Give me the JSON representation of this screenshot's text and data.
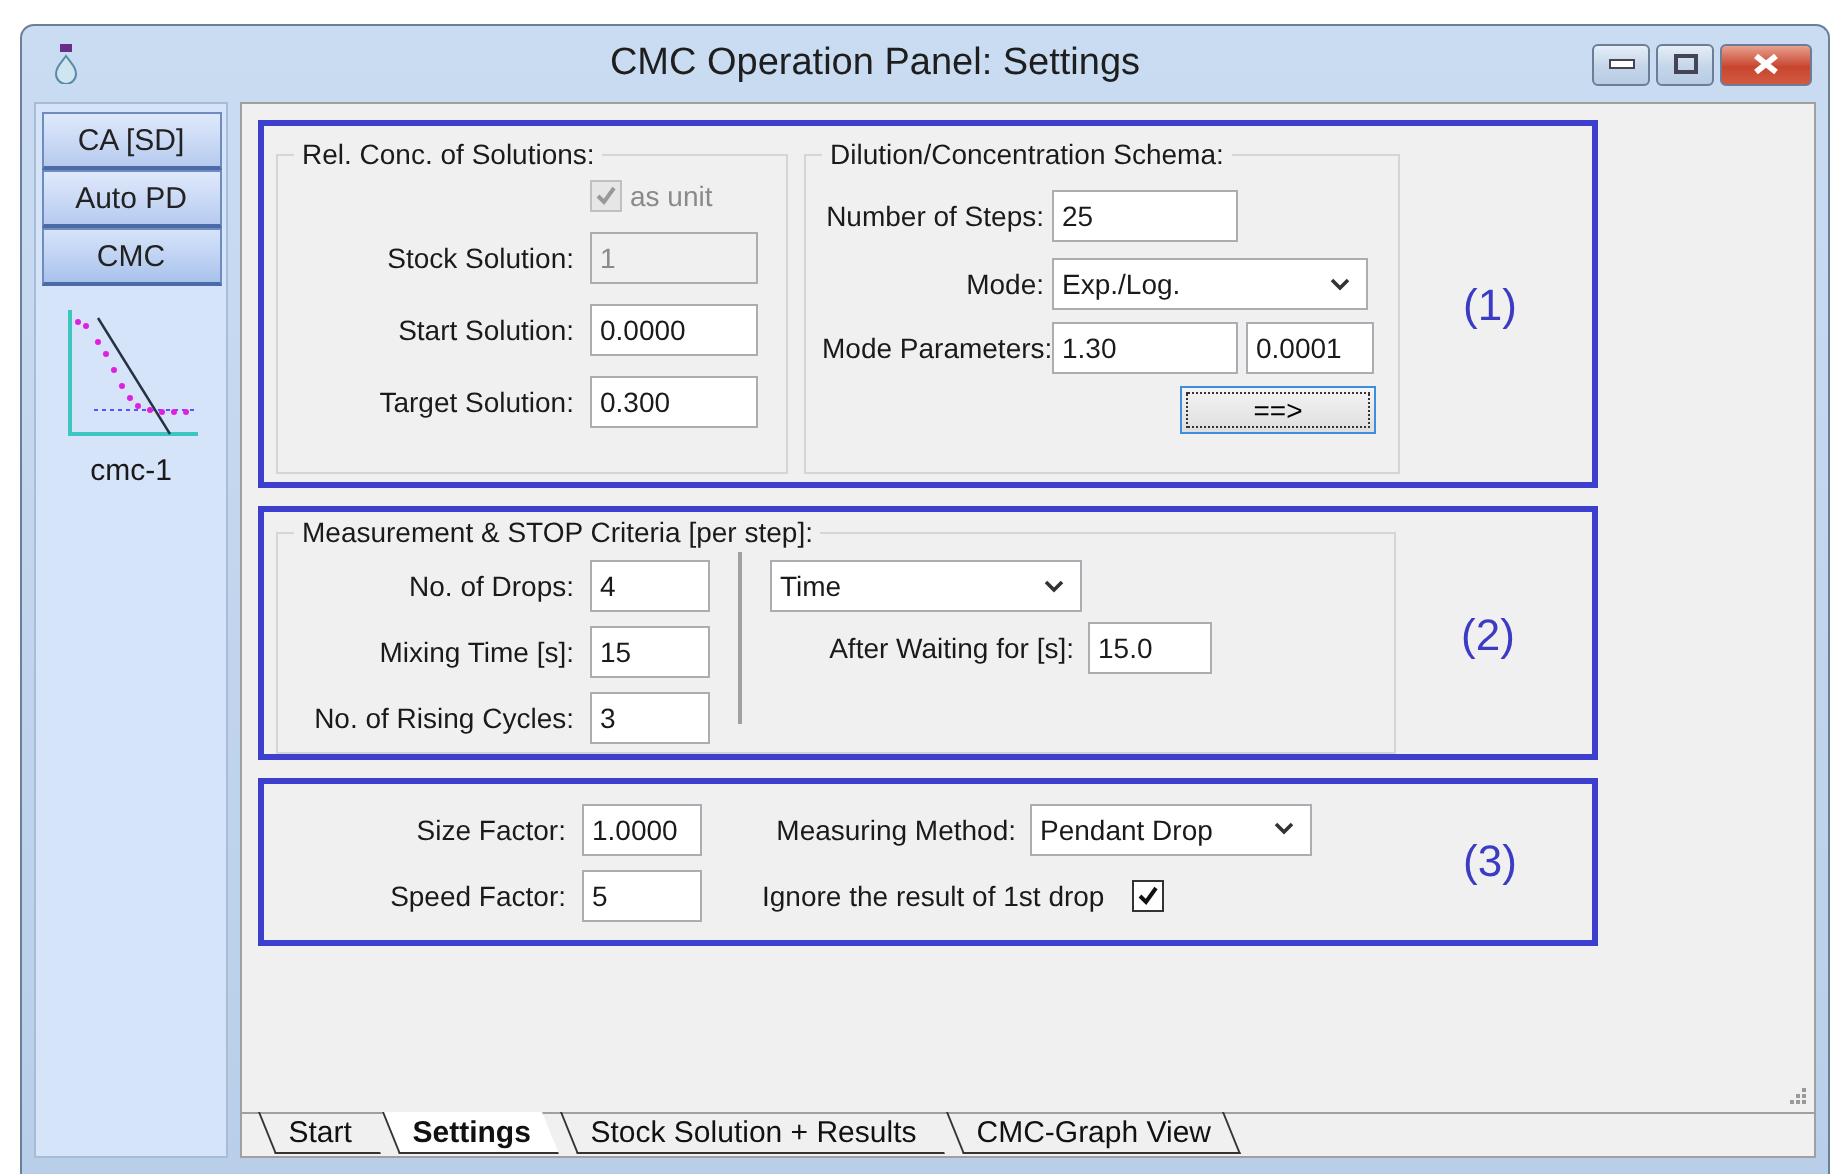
{
  "window": {
    "title": "CMC Operation Panel: Settings"
  },
  "sidebar": {
    "buttons": [
      {
        "label": "CA [SD]",
        "selected": false
      },
      {
        "label": "Auto PD",
        "selected": false
      },
      {
        "label": "CMC",
        "selected": true
      }
    ],
    "item_label": "cmc-1"
  },
  "section1": {
    "marker": "(1)",
    "concentration": {
      "title": "Rel. Conc. of Solutions:",
      "as_unit": {
        "label": "as unit",
        "checked": true,
        "disabled": true
      },
      "fields": [
        {
          "label": "Stock Solution:",
          "value": "1",
          "disabled": true
        },
        {
          "label": "Start Solution:",
          "value": "0.0000",
          "disabled": false
        },
        {
          "label": "Target Solution:",
          "value": "0.300",
          "disabled": false
        }
      ]
    },
    "dilution": {
      "title": "Dilution/Concentration Schema:",
      "steps": {
        "label": "Number of Steps:",
        "value": "25"
      },
      "mode": {
        "label": "Mode:",
        "value": "Exp./Log."
      },
      "parameters": {
        "label": "Mode Parameters:",
        "values": [
          "1.30",
          "0.0001"
        ]
      },
      "apply_button": "==>"
    }
  },
  "section2": {
    "marker": "(2)",
    "title": "Measurement & STOP Criteria [per step]:",
    "fields": [
      {
        "label": "No. of Drops:",
        "value": "4"
      },
      {
        "label": "Mixing Time [s]:",
        "value": "15"
      },
      {
        "label": "No. of Rising Cycles:",
        "value": "3"
      }
    ],
    "criterion": {
      "value": "Time"
    },
    "wait": {
      "label": "After Waiting for [s]:",
      "value": "15.0"
    }
  },
  "section3": {
    "marker": "(3)",
    "fields": [
      {
        "label": "Size Factor:",
        "value": "1.0000"
      },
      {
        "label": "Speed Factor:",
        "value": "5"
      }
    ],
    "method": {
      "label": "Measuring Method:",
      "value": "Pendant Drop"
    },
    "ignore_first": {
      "label": "Ignore the result of 1st drop",
      "checked": true
    }
  },
  "tabs": [
    {
      "label": "Start",
      "selected": false
    },
    {
      "label": "Settings",
      "selected": true
    },
    {
      "label": "Stock Solution + Results",
      "selected": false
    },
    {
      "label": "CMC-Graph View",
      "selected": false
    }
  ]
}
